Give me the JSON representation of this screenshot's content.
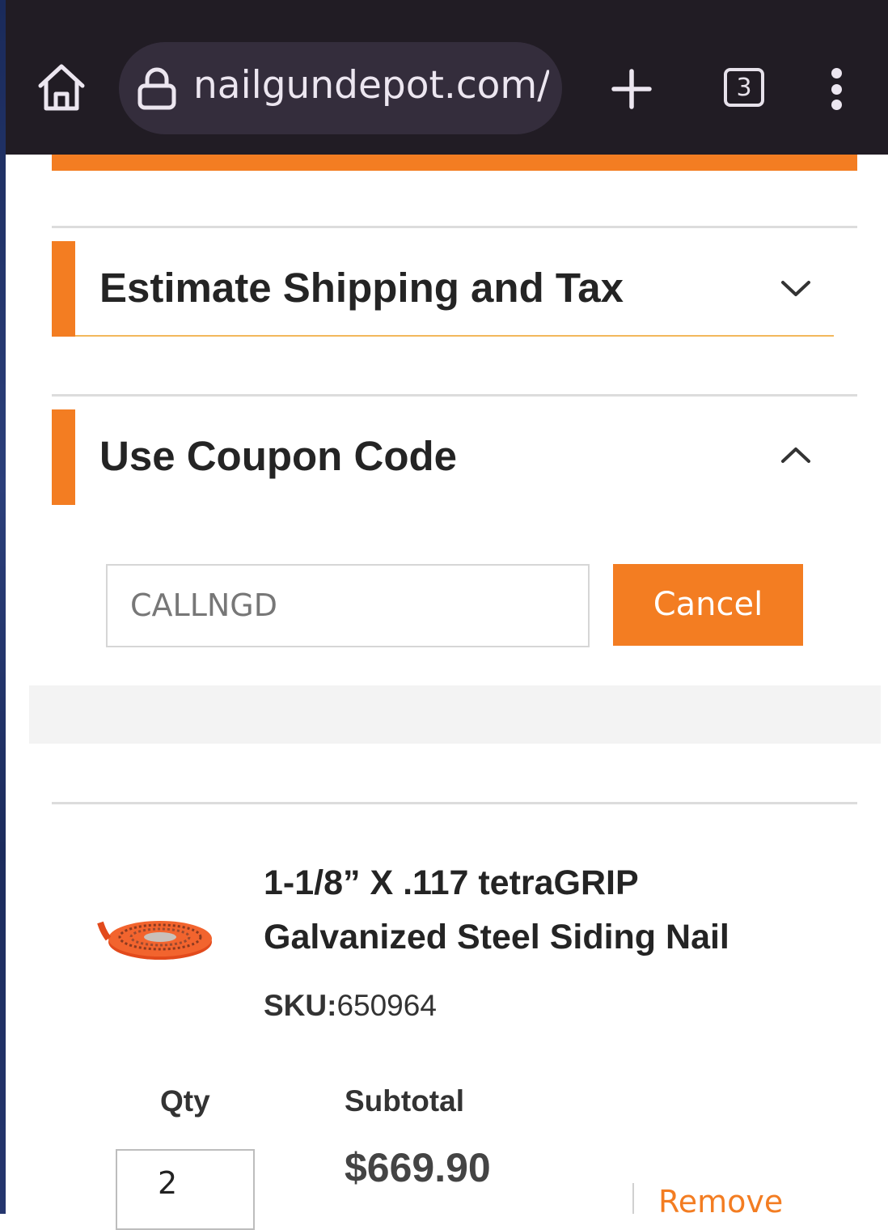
{
  "browser": {
    "url": "nailgundepot.com/c",
    "tab_count": "3",
    "icons": [
      "home-icon",
      "lock-icon",
      "plus-icon",
      "tabs-icon",
      "more-vert-icon"
    ]
  },
  "cart": {
    "shipping_section": {
      "title": "Estimate Shipping and Tax",
      "state": "collapsed",
      "icon": "chevron-down-icon"
    },
    "coupon_section": {
      "title": "Use Coupon Code",
      "state": "expanded",
      "icon": "chevron-up-icon"
    },
    "coupon": {
      "value": "CALLNGD",
      "cancel_label": "Cancel"
    },
    "item": {
      "name": "1-1/8” X .117 tetraGRIP Galvanized Steel Siding Nail",
      "sku_label": "SKU:",
      "sku": "650964",
      "qty_label": "Qty",
      "qty": "2",
      "subtotal_label": "Subtotal",
      "subtotal": "$669.90",
      "remove_label": "Remove"
    }
  },
  "colors": {
    "accent": "#f37d22",
    "browser_bar": "#211c24",
    "url_pill": "#342d3c"
  }
}
